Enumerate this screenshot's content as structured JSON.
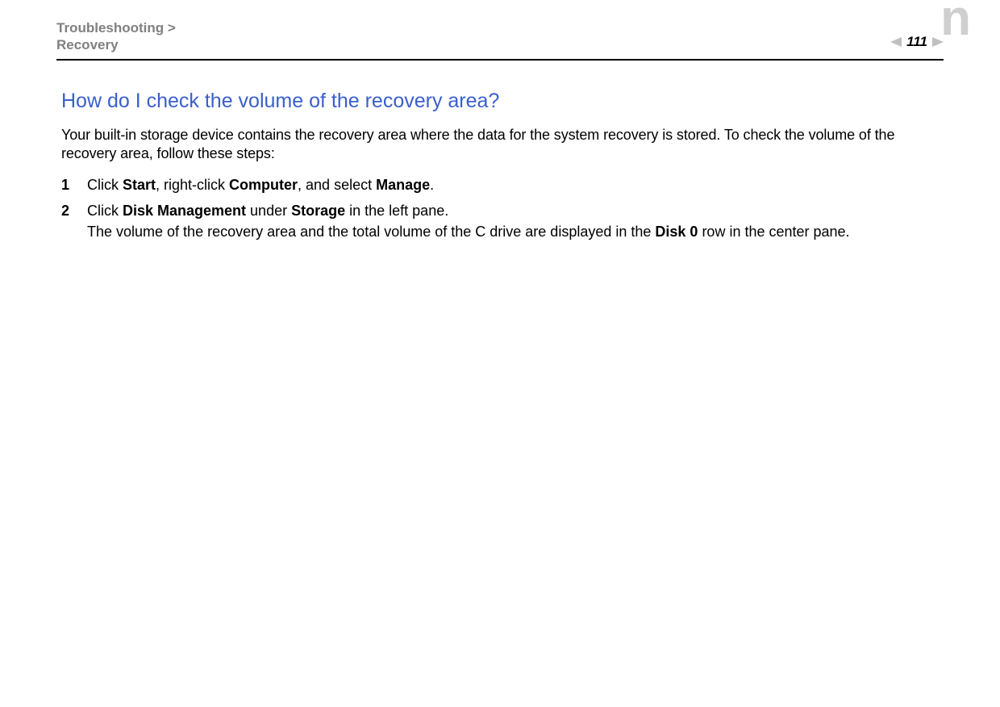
{
  "header": {
    "breadcrumb_line1": "Troubleshooting >",
    "breadcrumb_line2": "Recovery",
    "page_number": "111",
    "corner_letter": "n"
  },
  "content": {
    "title": "How do I check the volume of the recovery area?",
    "intro": "Your built-in storage device contains the recovery area where the data for the system recovery is stored. To check the volume of the recovery area, follow these steps:",
    "steps": [
      {
        "num": "1",
        "segments": [
          {
            "t": "Click "
          },
          {
            "t": "Start",
            "b": true
          },
          {
            "t": ", right-click "
          },
          {
            "t": "Computer",
            "b": true
          },
          {
            "t": ", and select "
          },
          {
            "t": "Manage",
            "b": true
          },
          {
            "t": "."
          }
        ]
      },
      {
        "num": "2",
        "segments": [
          {
            "t": "Click "
          },
          {
            "t": "Disk Management",
            "b": true
          },
          {
            "t": " under "
          },
          {
            "t": "Storage",
            "b": true
          },
          {
            "t": " in the left pane."
          },
          {
            "br": true
          },
          {
            "t": "The volume of the recovery area and the total volume of the C drive are displayed in the "
          },
          {
            "t": "Disk 0",
            "b": true
          },
          {
            "t": " row in the center pane."
          }
        ]
      }
    ]
  }
}
